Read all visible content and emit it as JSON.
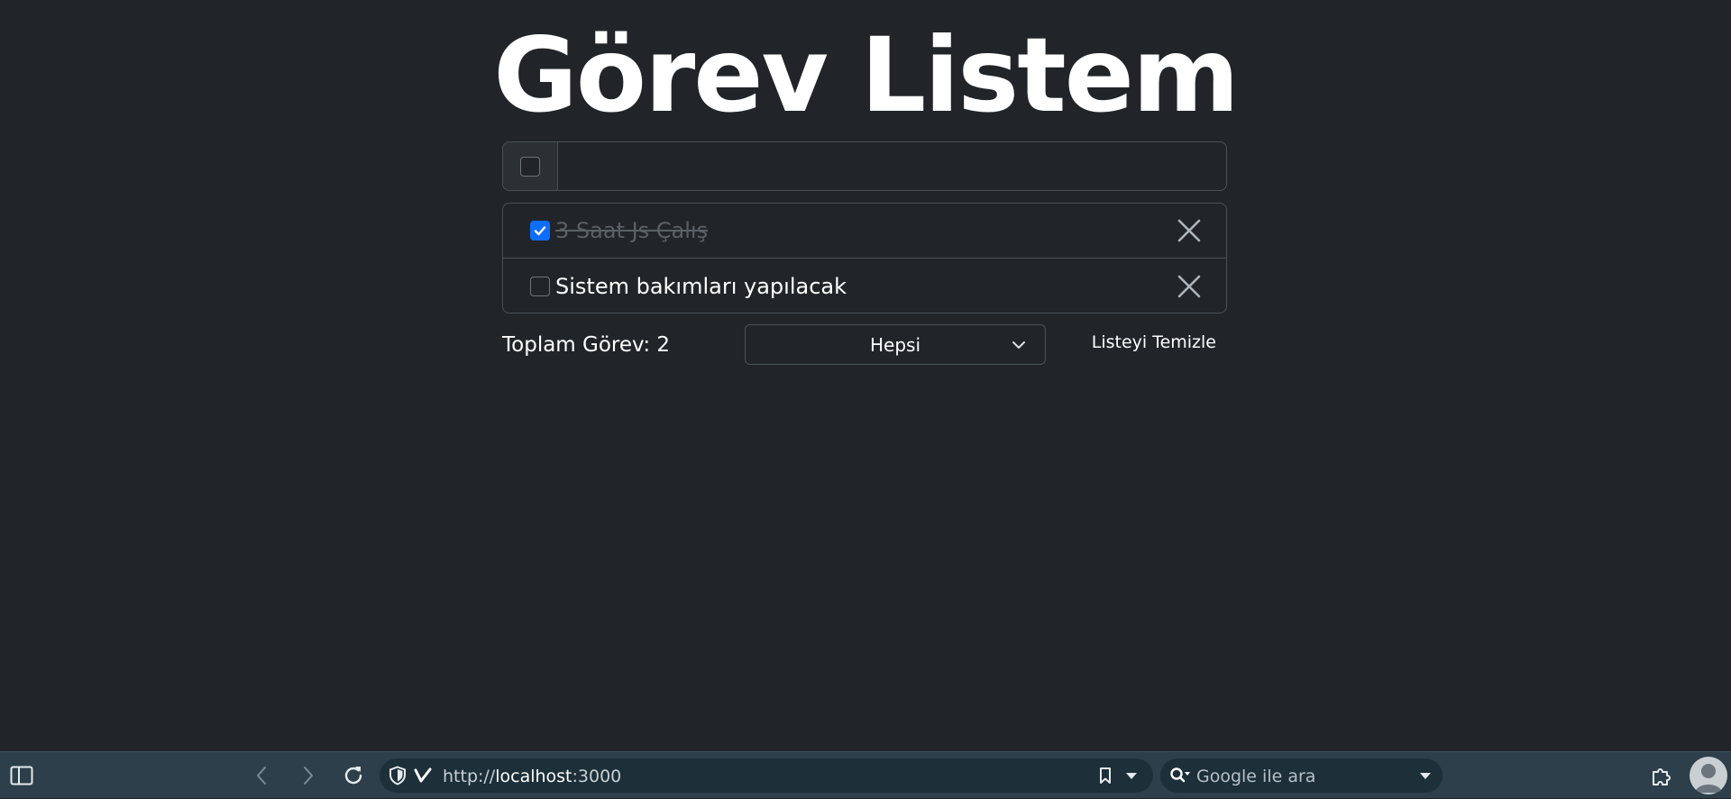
{
  "app": {
    "title": "Görev Listem",
    "new_task": {
      "value": "",
      "placeholder": ""
    },
    "tasks": [
      {
        "text": "3 Saat Js Çalış",
        "completed": true
      },
      {
        "text": "Sistem bakımları yapılacak",
        "completed": false
      }
    ],
    "footer": {
      "count_label": "Toplam Görev: 2",
      "filter_selected": "Hepsi",
      "clear_label": "Listeyi Temizle"
    }
  },
  "browser": {
    "url_prefix": "http://",
    "url_host": "localhost",
    "url_port": ":3000",
    "search_placeholder": "Google ile ara"
  },
  "colors": {
    "background": "#212529",
    "border": "#495057",
    "accent": "#0d6efd",
    "browser_bar": "#2c3f4a"
  },
  "icons": [
    "check-icon",
    "close-icon",
    "chevron-down-icon",
    "panel-toggle-icon",
    "back-icon",
    "forward-icon",
    "reload-icon",
    "shield-icon",
    "vivaldi-icon",
    "bookmark-icon",
    "dropdown-icon",
    "search-icon",
    "extensions-icon",
    "profile-icon"
  ]
}
